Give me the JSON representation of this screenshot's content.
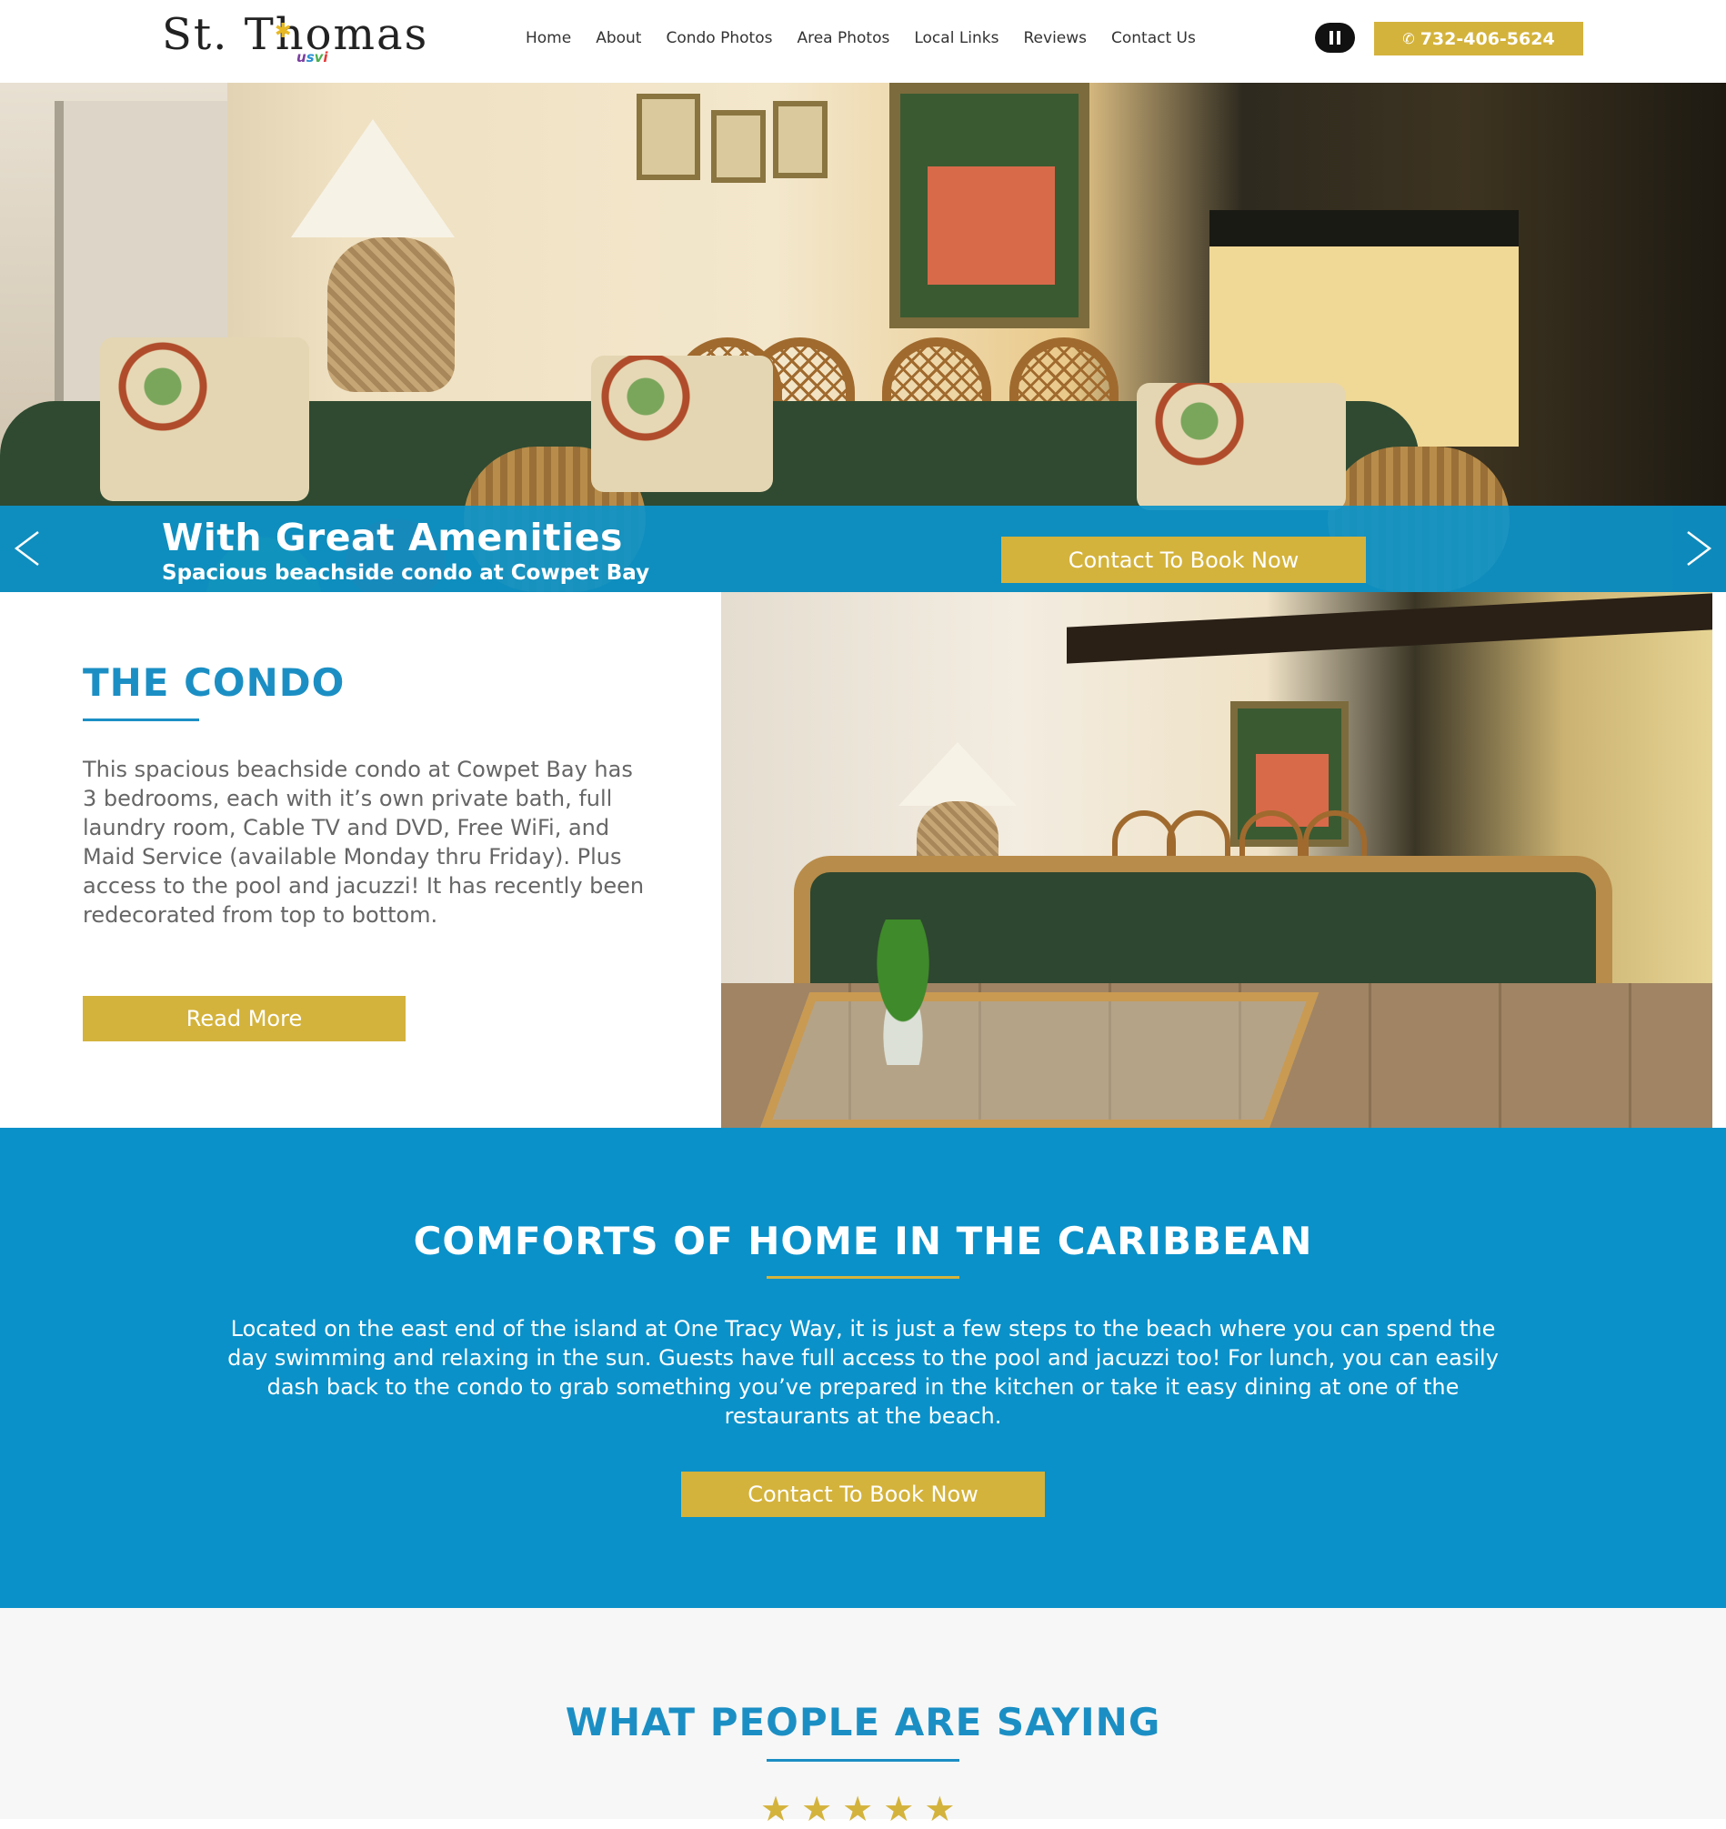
{
  "brand": {
    "logo_main": "St. Thomas",
    "logo_sub": [
      "u",
      "s",
      "v",
      "i"
    ]
  },
  "nav": {
    "items": [
      "Home",
      "About",
      "Condo Photos",
      "Area Photos",
      "Local Links",
      "Reviews",
      "Contact Us"
    ],
    "phone": "732-406-5624"
  },
  "hero": {
    "title": "With Great Amenities",
    "subtitle": "Spacious beachside condo at Cowpet Bay",
    "cta": "Contact To Book Now"
  },
  "condo": {
    "heading": "THE CONDO",
    "body": "This spacious beachside condo at Cowpet Bay has 3 bedrooms, each with it’s own private bath, full laundry room, Cable TV and DVD, Free WiFi, and Maid Service (available Monday thru Friday). Plus access to the pool and jacuzzi! It has recently been redecorated from top to bottom.",
    "button": "Read More"
  },
  "comforts": {
    "heading": "COMFORTS OF HOME IN THE CARIBBEAN",
    "body": "Located on the east end of the island at One Tracy Way, it is just a few steps to the beach where you can spend the day swimming and relaxing in the sun. Guests have full access to the pool and jacuzzi too! For lunch, you can easily dash back to the condo to grab something you’ve prepared in the kitchen or take it easy dining at one of the restaurants at the beach.",
    "button": "Contact To Book Now"
  },
  "reviews": {
    "heading": "WHAT PEOPLE ARE SAYING",
    "rating": 5
  },
  "icons": {
    "pause": "pause-icon",
    "phone": "phone-icon",
    "prev": "chevron-left-icon",
    "next": "chevron-right-icon",
    "star": "star-icon"
  },
  "colors": {
    "accent_blue": "#0a91c9",
    "heading_blue": "#1b8fc4",
    "gold": "#d4b33c"
  }
}
